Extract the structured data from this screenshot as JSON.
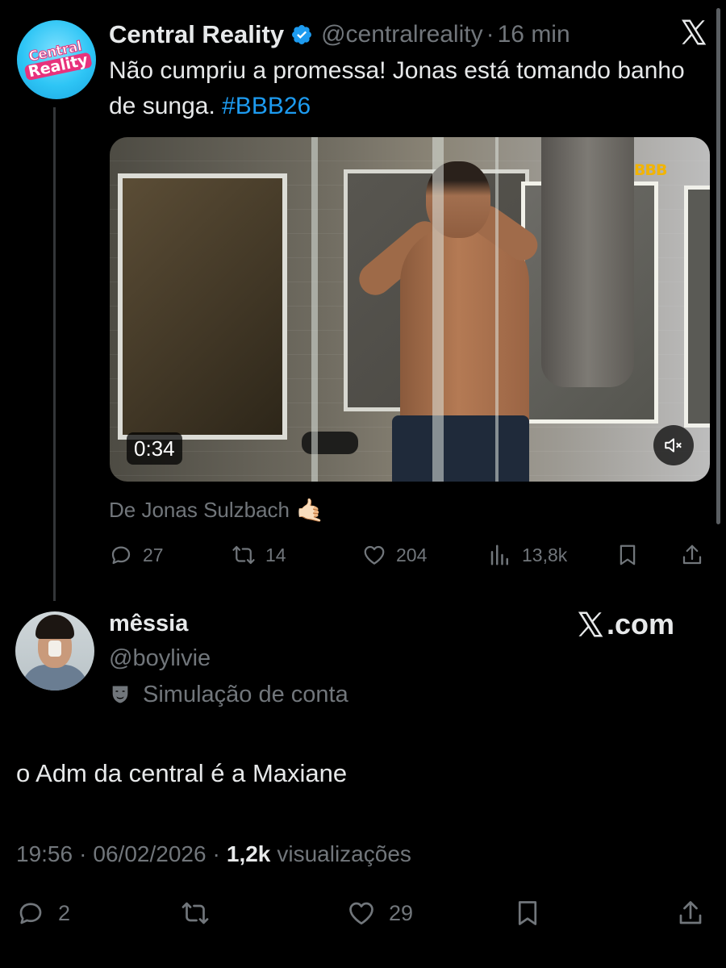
{
  "quoted_tweet": {
    "author_name": "Central Reality",
    "handle": "@centralreality",
    "separator": "·",
    "time": "16 min",
    "text": "Não cumpriu a promessa! Jonas está tomando banho de sunga.",
    "hashtag": "#BBB26",
    "media": {
      "duration": "0:34",
      "watermark": "BBB"
    },
    "attribution": "De Jonas Sulzbach",
    "attribution_emoji": "🤙🏻",
    "stats": {
      "replies": "27",
      "reposts": "14",
      "likes": "204",
      "views": "13,8k"
    },
    "avatar_text": [
      "Central",
      "Reality"
    ]
  },
  "reply": {
    "author_name": "mêssia",
    "handle": "@boylivie",
    "account_label": "Simulação de conta",
    "watermark": ".com",
    "text": "o Adm da central é a Maxiane",
    "time": "19:56",
    "date": "06/02/2026",
    "separator": "·",
    "views_count": "1,2k",
    "views_label": "visualizações",
    "stats": {
      "replies": "2",
      "likes": "29"
    }
  },
  "colors": {
    "background": "#000000",
    "text": "#e7e9ea",
    "secondary": "#71767b",
    "link": "#1d9bf0",
    "verified": "#1d9bf0"
  }
}
